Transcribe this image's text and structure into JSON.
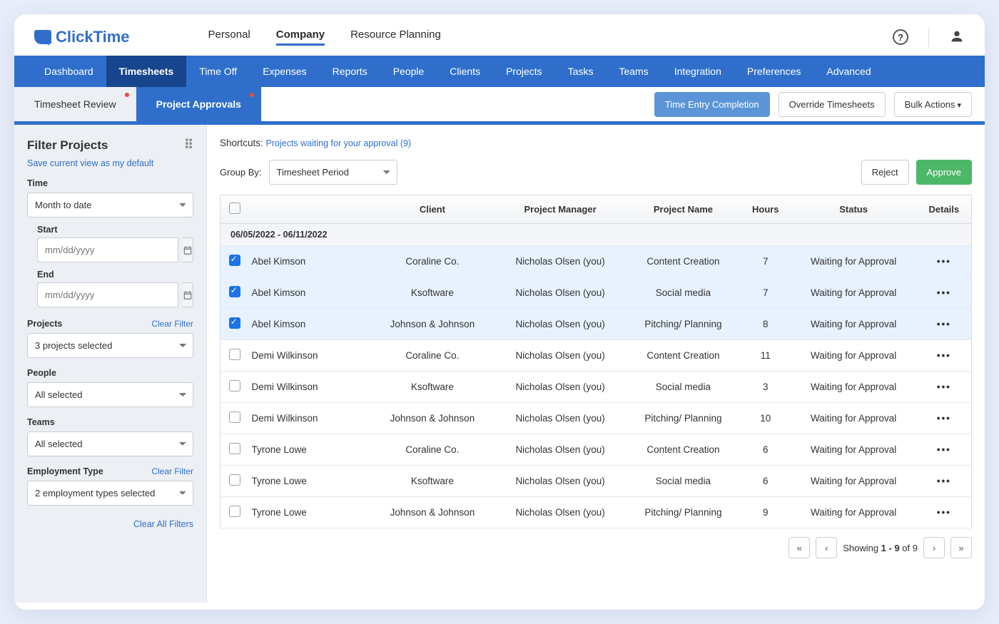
{
  "brand": "ClickTime",
  "top_nav": {
    "items": [
      "Personal",
      "Company",
      "Resource Planning"
    ],
    "active": "Company"
  },
  "main_nav": {
    "items": [
      "Dashboard",
      "Timesheets",
      "Time Off",
      "Expenses",
      "Reports",
      "People",
      "Clients",
      "Projects",
      "Tasks",
      "Teams",
      "Integration",
      "Preferences",
      "Advanced"
    ],
    "active": "Timesheets"
  },
  "sub_tabs": {
    "items": [
      "Timesheet Review",
      "Project Approvals"
    ],
    "active": "Project Approvals"
  },
  "sub_actions": {
    "time_entry": "Time Entry Completion",
    "override": "Override Timesheets",
    "bulk": "Bulk Actions"
  },
  "sidebar": {
    "title": "Filter Projects",
    "save_link": "Save current view as my default",
    "time": {
      "label": "Time",
      "selected": "Month to date",
      "start_label": "Start",
      "start_placeholder": "mm/dd/yyyy",
      "end_label": "End",
      "end_placeholder": "mm/dd/yyyy"
    },
    "projects": {
      "label": "Projects",
      "clear": "Clear Filter",
      "value": "3 projects selected"
    },
    "people": {
      "label": "People",
      "value": "All selected"
    },
    "teams": {
      "label": "Teams",
      "value": "All selected"
    },
    "employment": {
      "label": "Employment Type",
      "clear": "Clear Filter",
      "value": "2 employment types selected"
    },
    "clear_all": "Clear All Filters"
  },
  "shortcut": {
    "prefix": "Shortcuts: ",
    "link": "Projects waiting for your approval (9)"
  },
  "groupby": {
    "label": "Group By:",
    "value": "Timesheet Period"
  },
  "reject_label": "Reject",
  "approve_label": "Approve",
  "columns": {
    "client": "Client",
    "pm": "Project Manager",
    "project": "Project Name",
    "hours": "Hours",
    "status": "Status",
    "details": "Details"
  },
  "group_header": "06/05/2022 - 06/11/2022",
  "rows": [
    {
      "checked": true,
      "name": "Abel Kimson",
      "client": "Coraline Co.",
      "pm": "Nicholas Olsen (you)",
      "project": "Content Creation",
      "hours": "7",
      "status": "Waiting for Approval"
    },
    {
      "checked": true,
      "name": "Abel Kimson",
      "client": "Ksoftware",
      "pm": "Nicholas Olsen (you)",
      "project": "Social media",
      "hours": "7",
      "status": "Waiting for Approval"
    },
    {
      "checked": true,
      "name": "Abel Kimson",
      "client": "Johnson & Johnson",
      "pm": "Nicholas Olsen (you)",
      "project": "Pitching/ Planning",
      "hours": "8",
      "status": "Waiting for Approval"
    },
    {
      "checked": false,
      "name": "Demi Wilkinson",
      "client": "Coraline Co.",
      "pm": "Nicholas Olsen (you)",
      "project": "Content Creation",
      "hours": "11",
      "status": "Waiting for Approval"
    },
    {
      "checked": false,
      "name": "Demi Wilkinson",
      "client": "Ksoftware",
      "pm": "Nicholas Olsen (you)",
      "project": "Social media",
      "hours": "3",
      "status": "Waiting for Approval"
    },
    {
      "checked": false,
      "name": "Demi Wilkinson",
      "client": "Johnson & Johnson",
      "pm": "Nicholas Olsen (you)",
      "project": "Pitching/ Planning",
      "hours": "10",
      "status": "Waiting for Approval"
    },
    {
      "checked": false,
      "name": "Tyrone Lowe",
      "client": "Coraline Co.",
      "pm": "Nicholas Olsen (you)",
      "project": "Content Creation",
      "hours": "6",
      "status": "Waiting for Approval"
    },
    {
      "checked": false,
      "name": "Tyrone Lowe",
      "client": "Ksoftware",
      "pm": "Nicholas Olsen (you)",
      "project": "Social media",
      "hours": "6",
      "status": "Waiting for Approval"
    },
    {
      "checked": false,
      "name": "Tyrone Lowe",
      "client": "Johnson & Johnson",
      "pm": "Nicholas Olsen (you)",
      "project": "Pitching/ Planning",
      "hours": "9",
      "status": "Waiting for Approval"
    }
  ],
  "pager": {
    "text_prefix": "Showing ",
    "range": "1 - 9",
    "of": " of ",
    "total": "9"
  }
}
